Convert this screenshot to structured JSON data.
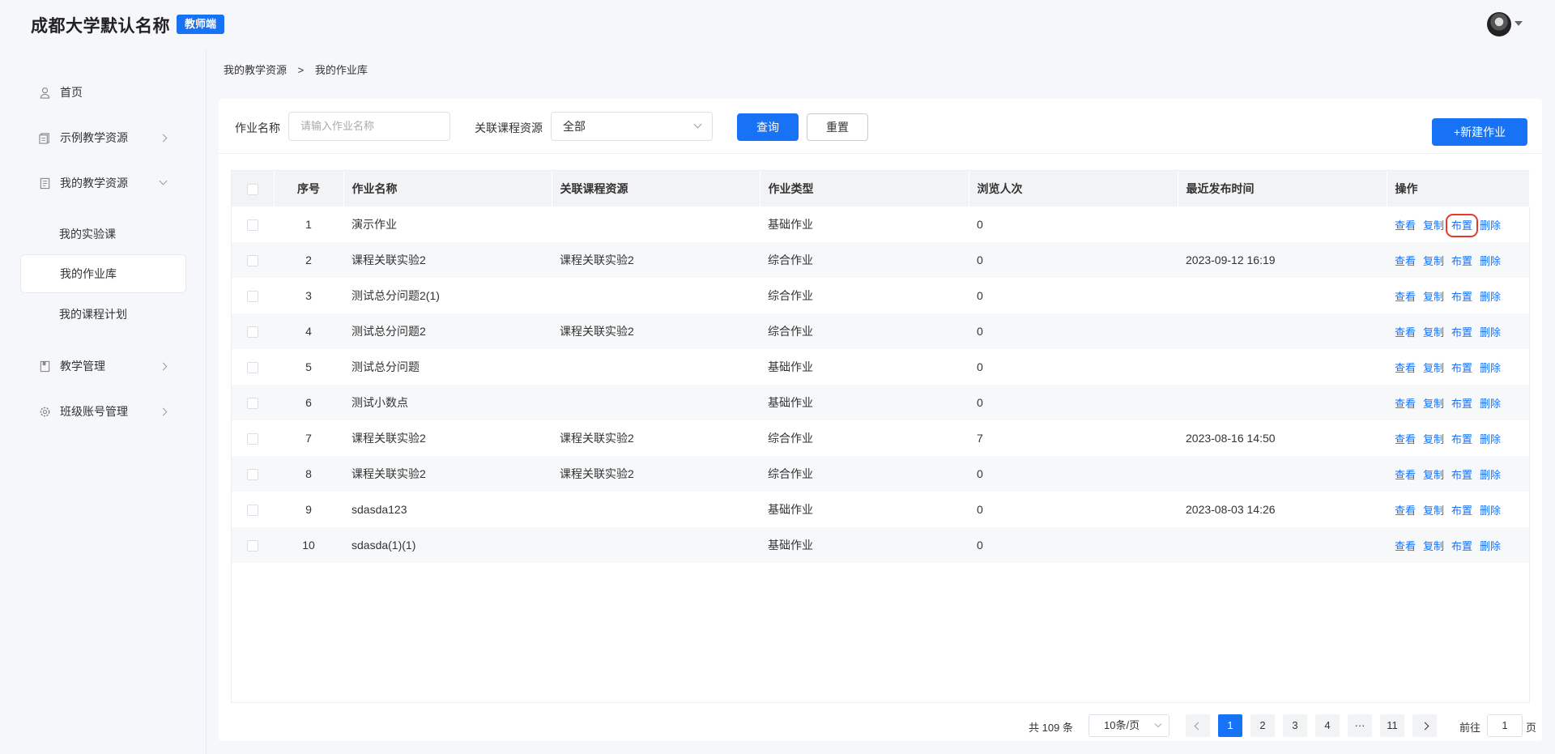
{
  "header": {
    "title": "成都大学默认名称",
    "role_badge": "教师端"
  },
  "sidebar": {
    "items": [
      {
        "label": "首页",
        "icon": "user-icon"
      },
      {
        "label": "示例教学资源",
        "icon": "book-icon"
      },
      {
        "label": "我的教学资源",
        "icon": "document-icon"
      },
      {
        "label": "教学管理",
        "icon": "notebook-icon"
      },
      {
        "label": "班级账号管理",
        "icon": "gear-icon"
      }
    ],
    "sub_items": [
      "我的实验课",
      "我的作业库",
      "我的课程计划"
    ]
  },
  "breadcrumb": {
    "parent": "我的教学资源",
    "separator": ">",
    "current": "我的作业库"
  },
  "filters": {
    "name_label": "作业名称",
    "name_placeholder": "请输入作业名称",
    "course_label": "关联课程资源",
    "course_value": "全部",
    "search_button": "查询",
    "reset_button": "重置",
    "new_button": "+新建作业"
  },
  "table": {
    "headers": [
      "序号",
      "作业名称",
      "关联课程资源",
      "作业类型",
      "浏览人次",
      "最近发布时间",
      "操作"
    ],
    "actions": [
      "查看",
      "复制",
      "布置",
      "删除"
    ],
    "rows": [
      {
        "no": "1",
        "name": "演示作业",
        "course": "",
        "type": "基础作业",
        "views": "0",
        "time": ""
      },
      {
        "no": "2",
        "name": "课程关联实验2",
        "course": "课程关联实验2",
        "type": "综合作业",
        "views": "0",
        "time": "2023-09-12 16:19"
      },
      {
        "no": "3",
        "name": "测试总分问题2(1)",
        "course": "",
        "type": "综合作业",
        "views": "0",
        "time": ""
      },
      {
        "no": "4",
        "name": "测试总分问题2",
        "course": "课程关联实验2",
        "type": "综合作业",
        "views": "0",
        "time": ""
      },
      {
        "no": "5",
        "name": "测试总分问题",
        "course": "",
        "type": "基础作业",
        "views": "0",
        "time": ""
      },
      {
        "no": "6",
        "name": "测试小数点",
        "course": "",
        "type": "基础作业",
        "views": "0",
        "time": ""
      },
      {
        "no": "7",
        "name": "课程关联实验2",
        "course": "课程关联实验2",
        "type": "综合作业",
        "views": "7",
        "time": "2023-08-16 14:50"
      },
      {
        "no": "8",
        "name": "课程关联实验2",
        "course": "课程关联实验2",
        "type": "综合作业",
        "views": "0",
        "time": ""
      },
      {
        "no": "9",
        "name": "sdasda123",
        "course": "",
        "type": "基础作业",
        "views": "0",
        "time": "2023-08-03 14:26"
      },
      {
        "no": "10",
        "name": "sdasda(1)(1)",
        "course": "",
        "type": "基础作业",
        "views": "0",
        "time": ""
      }
    ]
  },
  "pagination": {
    "total_text": "共 109 条",
    "page_size": "10条/页",
    "pages": [
      "1",
      "2",
      "3",
      "4",
      "···",
      "11"
    ],
    "current_page": "1",
    "goto_label": "前往",
    "goto_value": "1",
    "goto_suffix": "页"
  },
  "colors": {
    "primary": "#1772f6",
    "highlight_box": "#e53a2a"
  }
}
